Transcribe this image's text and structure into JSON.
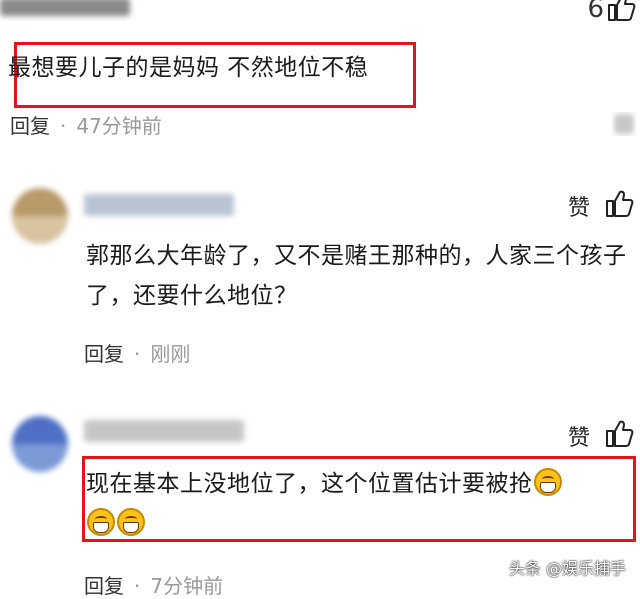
{
  "comment1": {
    "like_count": "6",
    "text": "最想要儿子的是妈妈 不然地位不稳",
    "reply_label": "回复",
    "separator": "·",
    "time": "47分钟前"
  },
  "comment2": {
    "like_label": "赞",
    "text": "郭那么大年龄了，又不是赌王那种的，人家三个孩子了，还要什么地位？",
    "reply_label": "回复",
    "separator": "·",
    "time": "刚刚"
  },
  "comment3": {
    "like_label": "赞",
    "text": "现在基本上没地位了，这个位置估计要被抢",
    "reply_label": "回复",
    "separator": "·",
    "time": "7分钟前"
  },
  "watermark": "头条 @娱乐捕手",
  "colors": {
    "highlight_border": "#e0161b"
  }
}
